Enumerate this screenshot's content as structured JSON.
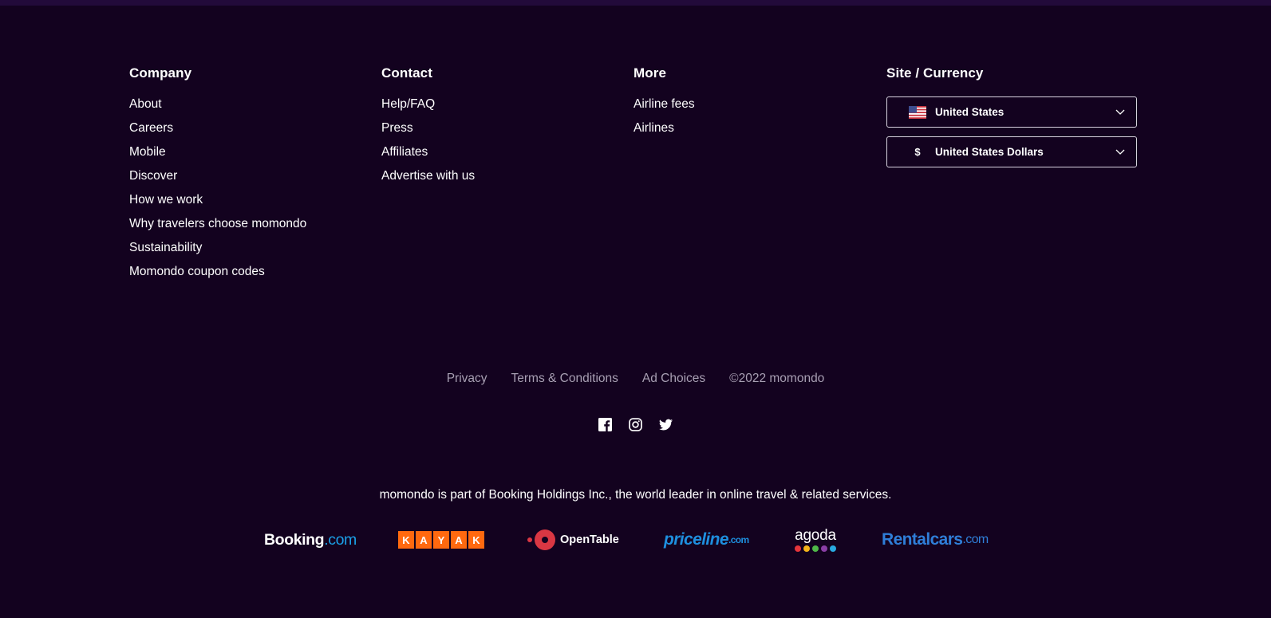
{
  "company": {
    "heading": "Company",
    "links": [
      "About",
      "Careers",
      "Mobile",
      "Discover",
      "How we work",
      "Why travelers choose momondo",
      "Sustainability",
      "Momondo coupon codes"
    ]
  },
  "contact": {
    "heading": "Contact",
    "links": [
      "Help/FAQ",
      "Press",
      "Affiliates",
      "Advertise with us"
    ]
  },
  "more": {
    "heading": "More",
    "links": [
      "Airline fees",
      "Airlines"
    ]
  },
  "site": {
    "heading": "Site / Currency",
    "country": "United States",
    "currency_symbol": "$",
    "currency": "United States Dollars"
  },
  "legal": {
    "privacy": "Privacy",
    "terms": "Terms & Conditions",
    "ad_choices": "Ad Choices",
    "copyright": "©2022 momondo"
  },
  "social": [
    "facebook-icon",
    "instagram-icon",
    "twitter-icon"
  ],
  "parent_text": "momondo is part of Booking Holdings Inc., the world leader in online travel & related services.",
  "brands": {
    "booking_main": "Booking",
    "booking_suffix": ".com",
    "kayak": [
      "K",
      "A",
      "Y",
      "A",
      "K"
    ],
    "opentable": "OpenTable",
    "priceline_main": "priceline",
    "priceline_suffix": ".com",
    "agoda": "agoda",
    "rental_main": "Rentalcars",
    "rental_suffix": ".com"
  },
  "colors": {
    "background": "#13021f",
    "kayak": "#ff690f",
    "opentable": "#da3743",
    "priceline": "#1e8fdf",
    "rentalcars": "#2f7ed8",
    "agoda_dots": [
      "#e5353b",
      "#f4b41a",
      "#4fb848",
      "#8a3ea5",
      "#29a9e1"
    ]
  }
}
